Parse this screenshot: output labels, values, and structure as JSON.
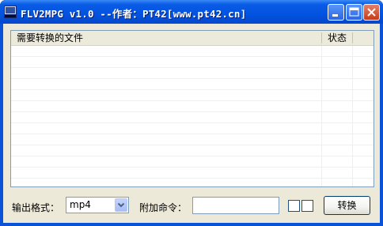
{
  "window": {
    "title": "FLV2MPG v1.0 --作者：PT42[www.pt42.cn]",
    "controls": [
      "minimize",
      "maximize",
      "close"
    ]
  },
  "file_list": {
    "columns": [
      "需要转换的文件",
      "状态"
    ],
    "rows": []
  },
  "format": {
    "label": "输出格式：",
    "selected": "mp4"
  },
  "extra_command": {
    "label": "附加命令：",
    "value": ""
  },
  "convert_button": {
    "label": "转换"
  },
  "colors": {
    "titlebar": "#0254e0",
    "client_bg": "#ece9d8",
    "border": "#7f9db9"
  }
}
